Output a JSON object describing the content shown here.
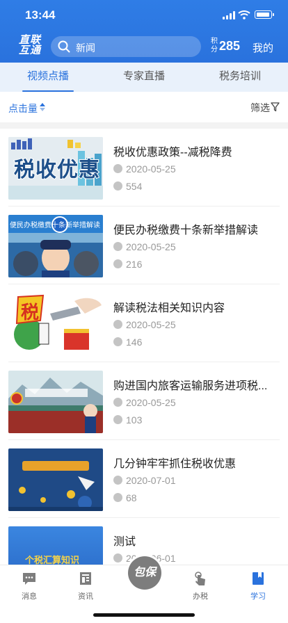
{
  "status": {
    "time": "13:44"
  },
  "header": {
    "logo_line1": "直联",
    "logo_line2": "互通",
    "search_placeholder": "新闻",
    "points_label": "积分",
    "points_value": "285",
    "mine_label": "我的"
  },
  "tabs": [
    {
      "label": "视频点播",
      "active": true
    },
    {
      "label": "专家直播",
      "active": false
    },
    {
      "label": "税务培训",
      "active": false
    }
  ],
  "filters": {
    "sort_label": "点击量",
    "screen_label": "筛选"
  },
  "videos": [
    {
      "title": "税收优惠政策--减税降费",
      "date": "2020-05-25",
      "views": "554",
      "thumb_text": "税收优惠"
    },
    {
      "title": "便民办税缴费十条新举措解读",
      "date": "2020-05-25",
      "views": "216",
      "thumb_text": "便民办税缴费十条新举措解读"
    },
    {
      "title": "解读税法相关知识内容",
      "date": "2020-05-25",
      "views": "146",
      "thumb_text": "税"
    },
    {
      "title": "购进国内旅客运输服务进项税...",
      "date": "2020-05-25",
      "views": "103",
      "thumb_text": ""
    },
    {
      "title": "几分钟牢牢抓住税收优惠",
      "date": "2020-07-01",
      "views": "68",
      "thumb_text": ""
    },
    {
      "title": "测试",
      "date": "2020-06-01",
      "views": "",
      "thumb_text": "个税汇算知识"
    }
  ],
  "bottom_nav": [
    {
      "label": "消息",
      "icon": "message-icon"
    },
    {
      "label": "资讯",
      "icon": "news-icon"
    },
    {
      "label": "办税",
      "icon": "tap-icon"
    },
    {
      "label": "学习",
      "icon": "book-icon",
      "active": true
    }
  ],
  "fab_label": "包保",
  "colors": {
    "brand": "#2a72dd",
    "tab_bg": "#e9f1fb",
    "meta": "#999999"
  }
}
